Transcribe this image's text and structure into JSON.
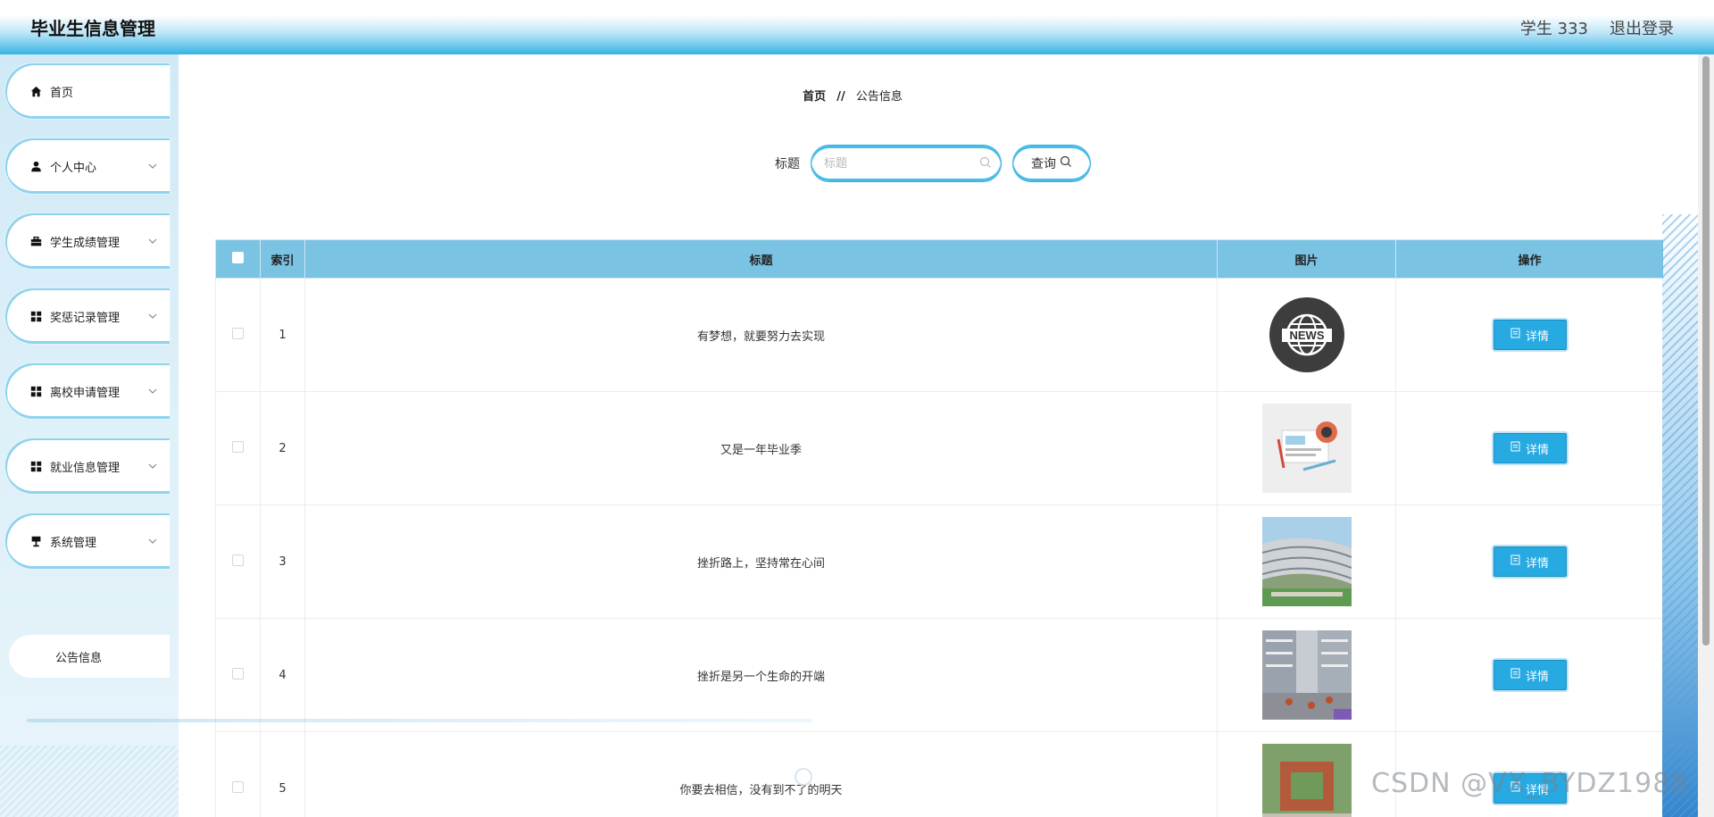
{
  "header": {
    "title": "毕业生信息管理",
    "user": "学生 333",
    "logout": "退出登录"
  },
  "sidebar": {
    "items": [
      {
        "label": "首页",
        "icon": "home-icon"
      },
      {
        "label": "个人中心",
        "icon": "user-icon"
      },
      {
        "label": "学生成绩管理",
        "icon": "briefcase-icon"
      },
      {
        "label": "奖惩记录管理",
        "icon": "grid-icon"
      },
      {
        "label": "离校申请管理",
        "icon": "grid-icon"
      },
      {
        "label": "就业信息管理",
        "icon": "grid-icon"
      },
      {
        "label": "系统管理",
        "icon": "sign-icon"
      }
    ],
    "sub_item": "公告信息"
  },
  "breadcrumb": {
    "home": "首页",
    "sep": "//",
    "current": "公告信息"
  },
  "search": {
    "label": "标题",
    "placeholder": "标题",
    "button": "查询"
  },
  "table": {
    "headers": {
      "index": "索引",
      "title": "标题",
      "image": "图片",
      "action": "操作"
    },
    "rows": [
      {
        "index": "1",
        "title": "有梦想，就要努力去实现",
        "action": "详情"
      },
      {
        "index": "2",
        "title": "又是一年毕业季",
        "action": "详情"
      },
      {
        "index": "3",
        "title": "挫折路上，坚持常在心间",
        "action": "详情"
      },
      {
        "index": "4",
        "title": "挫折是另一个生命的开端",
        "action": "详情"
      },
      {
        "index": "5",
        "title": "你要去相信，没有到不了的明天",
        "action": "详情"
      }
    ]
  },
  "news_logo_text": "NEWS",
  "watermark": "CSDN @VX_BYDZ1988",
  "colors": {
    "accent": "#27a9e1",
    "table_header": "#7ac3e3",
    "header_gradient_end": "#37b3e4"
  }
}
